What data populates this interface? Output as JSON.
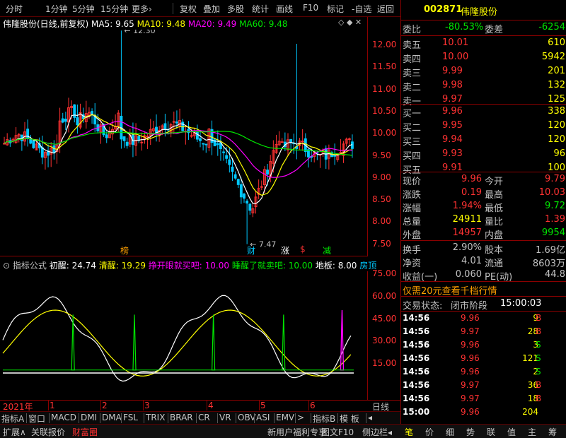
{
  "toolbar": {
    "items": [
      "分时",
      "1分钟",
      "5分钟",
      "15分钟",
      "更多›",
      "复权",
      "叠加",
      "多股",
      "统计",
      "画线",
      "F10",
      "标记",
      "-自选",
      "返回"
    ]
  },
  "chart": {
    "title": "伟隆股份(日线,前复权)",
    "ma": [
      {
        "label": "MA5: 9.65",
        "color": "#ffffff"
      },
      {
        "label": "MA10: 9.48",
        "color": "#ffff00"
      },
      {
        "label": "MA20: 9.49",
        "color": "#ff00ff"
      },
      {
        "label": "MA60: 9.48",
        "color": "#00e600"
      }
    ],
    "high_label": "12.30",
    "low_label": "7.47",
    "price_ticks": [
      "12.00",
      "11.50",
      "11.00",
      "10.50",
      "10.00",
      "9.50",
      "9.00",
      "8.50",
      "8.00",
      "7.50"
    ],
    "markers": [
      {
        "text": "榜",
        "color": "#ffa000"
      },
      {
        "text": "财",
        "color": "#00c8ff"
      },
      {
        "text": "涨",
        "color": "#ffffff"
      },
      {
        "text": "$",
        "color": "#ff3232"
      },
      {
        "text": "减",
        "color": "#00e600"
      }
    ]
  },
  "indicator": {
    "name": "指标公式",
    "params": [
      {
        "label": "初醒: 24.74",
        "color": "#ffffff"
      },
      {
        "label": "清醒: 19.29",
        "color": "#ffff00"
      },
      {
        "label": "挣开眼就买吧: 10.00",
        "color": "#ff00ff"
      },
      {
        "label": "睡醒了就卖吧: 10.00",
        "color": "#00e600"
      },
      {
        "label": "地板: 8.00",
        "color": "#ffffff"
      },
      {
        "label": "房顶",
        "color": "#00c8ff"
      }
    ],
    "ticks": [
      "75.00",
      "60.00",
      "45.00",
      "30.00",
      "15.00"
    ]
  },
  "dates": {
    "year": "2021年",
    "months": [
      "1",
      "2",
      "3",
      "4",
      "5",
      "6"
    ],
    "period": "日线"
  },
  "tabs": [
    "指标A",
    "窗口",
    "MACD",
    "DMI",
    "DMA",
    "FSL",
    "TRIX",
    "BRAR",
    "CR",
    "VR",
    "OBV",
    "ASI",
    "EMV",
    ">",
    "指标B",
    "模 板",
    "◂"
  ],
  "bottom": {
    "left": [
      "扩展∧",
      "关联报价",
      "财富圈"
    ],
    "right": [
      "新用户福利专享",
      "图文F10",
      "侧边栏◂"
    ],
    "icons": [
      "笔",
      "价",
      "细",
      "势",
      "联",
      "值",
      "主",
      "筹"
    ]
  },
  "quote": {
    "code": "002871",
    "name": "伟隆股份",
    "weibi_label": "委比",
    "weibi": "-80.53%",
    "weicha_label": "委差",
    "weicha": "-6254",
    "sell": [
      {
        "label": "卖五",
        "price": "10.01",
        "vol": "610"
      },
      {
        "label": "卖四",
        "price": "10.00",
        "vol": "5942"
      },
      {
        "label": "卖三",
        "price": "9.99",
        "vol": "201"
      },
      {
        "label": "卖二",
        "price": "9.98",
        "vol": "132"
      },
      {
        "label": "卖一",
        "price": "9.97",
        "vol": "125"
      }
    ],
    "buy": [
      {
        "label": "买一",
        "price": "9.96",
        "vol": "338"
      },
      {
        "label": "买二",
        "price": "9.95",
        "vol": "120"
      },
      {
        "label": "买三",
        "price": "9.94",
        "vol": "120"
      },
      {
        "label": "买四",
        "price": "9.93",
        "vol": "96"
      },
      {
        "label": "买五",
        "price": "9.91",
        "vol": "100"
      }
    ],
    "stats1": [
      {
        "l1": "现价",
        "v1": "9.96",
        "c1": "#ff3232",
        "l2": "今开",
        "v2": "9.79",
        "c2": "#ff3232"
      },
      {
        "l1": "涨跌",
        "v1": "0.19",
        "c1": "#ff3232",
        "l2": "最高",
        "v2": "10.03",
        "c2": "#ff3232"
      },
      {
        "l1": "涨幅",
        "v1": "1.94%",
        "c1": "#ff3232",
        "l2": "最低",
        "v2": "9.72",
        "c2": "#00e600"
      },
      {
        "l1": "总量",
        "v1": "24911",
        "c1": "#ffff00",
        "l2": "量比",
        "v2": "1.39",
        "c2": "#ff3232"
      },
      {
        "l1": "外盘",
        "v1": "14957",
        "c1": "#ff3232",
        "l2": "内盘",
        "v2": "9954",
        "c2": "#00e600"
      }
    ],
    "stats2": [
      {
        "l1": "换手",
        "v1": "2.90%",
        "l2": "股本",
        "v2": "1.69亿"
      },
      {
        "l1": "净资",
        "v1": "4.01",
        "l2": "流通",
        "v2": "8603万"
      },
      {
        "l1": "收益(一)",
        "v1": "0.060",
        "l2": "PE(动)",
        "v2": "44.8"
      }
    ],
    "promo": "仅需20元查看千档行情",
    "status_label": "交易状态:",
    "status": "闭市阶段",
    "status_time": "15:00:03",
    "trades": [
      {
        "t": "14:56",
        "p": "9.96",
        "v": "9",
        "s": "B"
      },
      {
        "t": "14:56",
        "p": "9.97",
        "v": "28",
        "s": "B"
      },
      {
        "t": "14:56",
        "p": "9.96",
        "v": "3",
        "s": "S"
      },
      {
        "t": "14:56",
        "p": "9.96",
        "v": "121",
        "s": "S"
      },
      {
        "t": "14:56",
        "p": "9.96",
        "v": "2",
        "s": "S"
      },
      {
        "t": "14:56",
        "p": "9.97",
        "v": "36",
        "s": "B"
      },
      {
        "t": "14:56",
        "p": "9.97",
        "v": "18",
        "s": "B"
      },
      {
        "t": "15:00",
        "p": "9.96",
        "v": "204",
        "s": ""
      }
    ]
  }
}
